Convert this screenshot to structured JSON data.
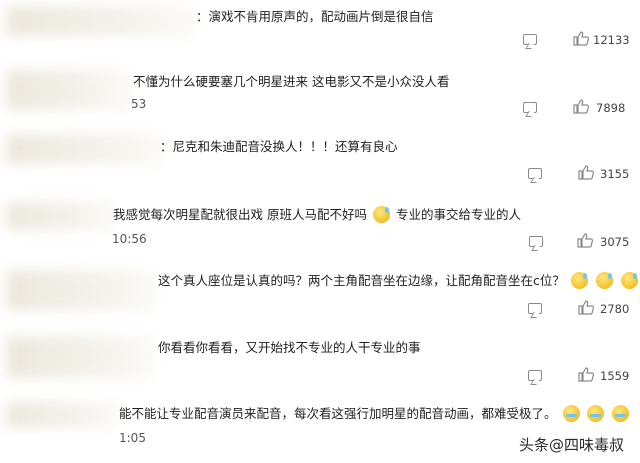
{
  "comments": [
    {
      "text": "：演戏不肯用原声的，配动画片倒是很自信",
      "stamp": "",
      "likes": "12133"
    },
    {
      "text": "不懂为什么硬要塞几个明星进来 这电影又不是小众没人看",
      "stamp": "53",
      "likes": "7898"
    },
    {
      "text": "：尼克和朱迪配音没换人！！！还算有良心",
      "stamp": "",
      "likes": "3155"
    },
    {
      "text": "我感觉每次明星配就很出戏 原班人马配不好吗",
      "text2": "专业的事交给专业的人",
      "stamp": "10:56",
      "likes": "3075"
    },
    {
      "text": "这个真人座位是认真的吗？两个主角配音坐在边缘，让配角配音坐在c位？",
      "stamp": "",
      "likes": "2780"
    },
    {
      "text": "你看看你看看，又开始找不专业的人干专业的事",
      "stamp": "",
      "likes": "1559"
    },
    {
      "text": "能不能让专业配音演员来配音，每次看这强行加明星的配音动画，都难受极了。",
      "stamp": "1:05",
      "likes": ""
    }
  ],
  "icons": {
    "reply": "comment-icon",
    "like": "thumbs-up-icon",
    "emoji_sweat": "sweat-smile-emoji",
    "emoji_cry": "crying-emoji"
  },
  "watermark": "头条@四味毒叔"
}
